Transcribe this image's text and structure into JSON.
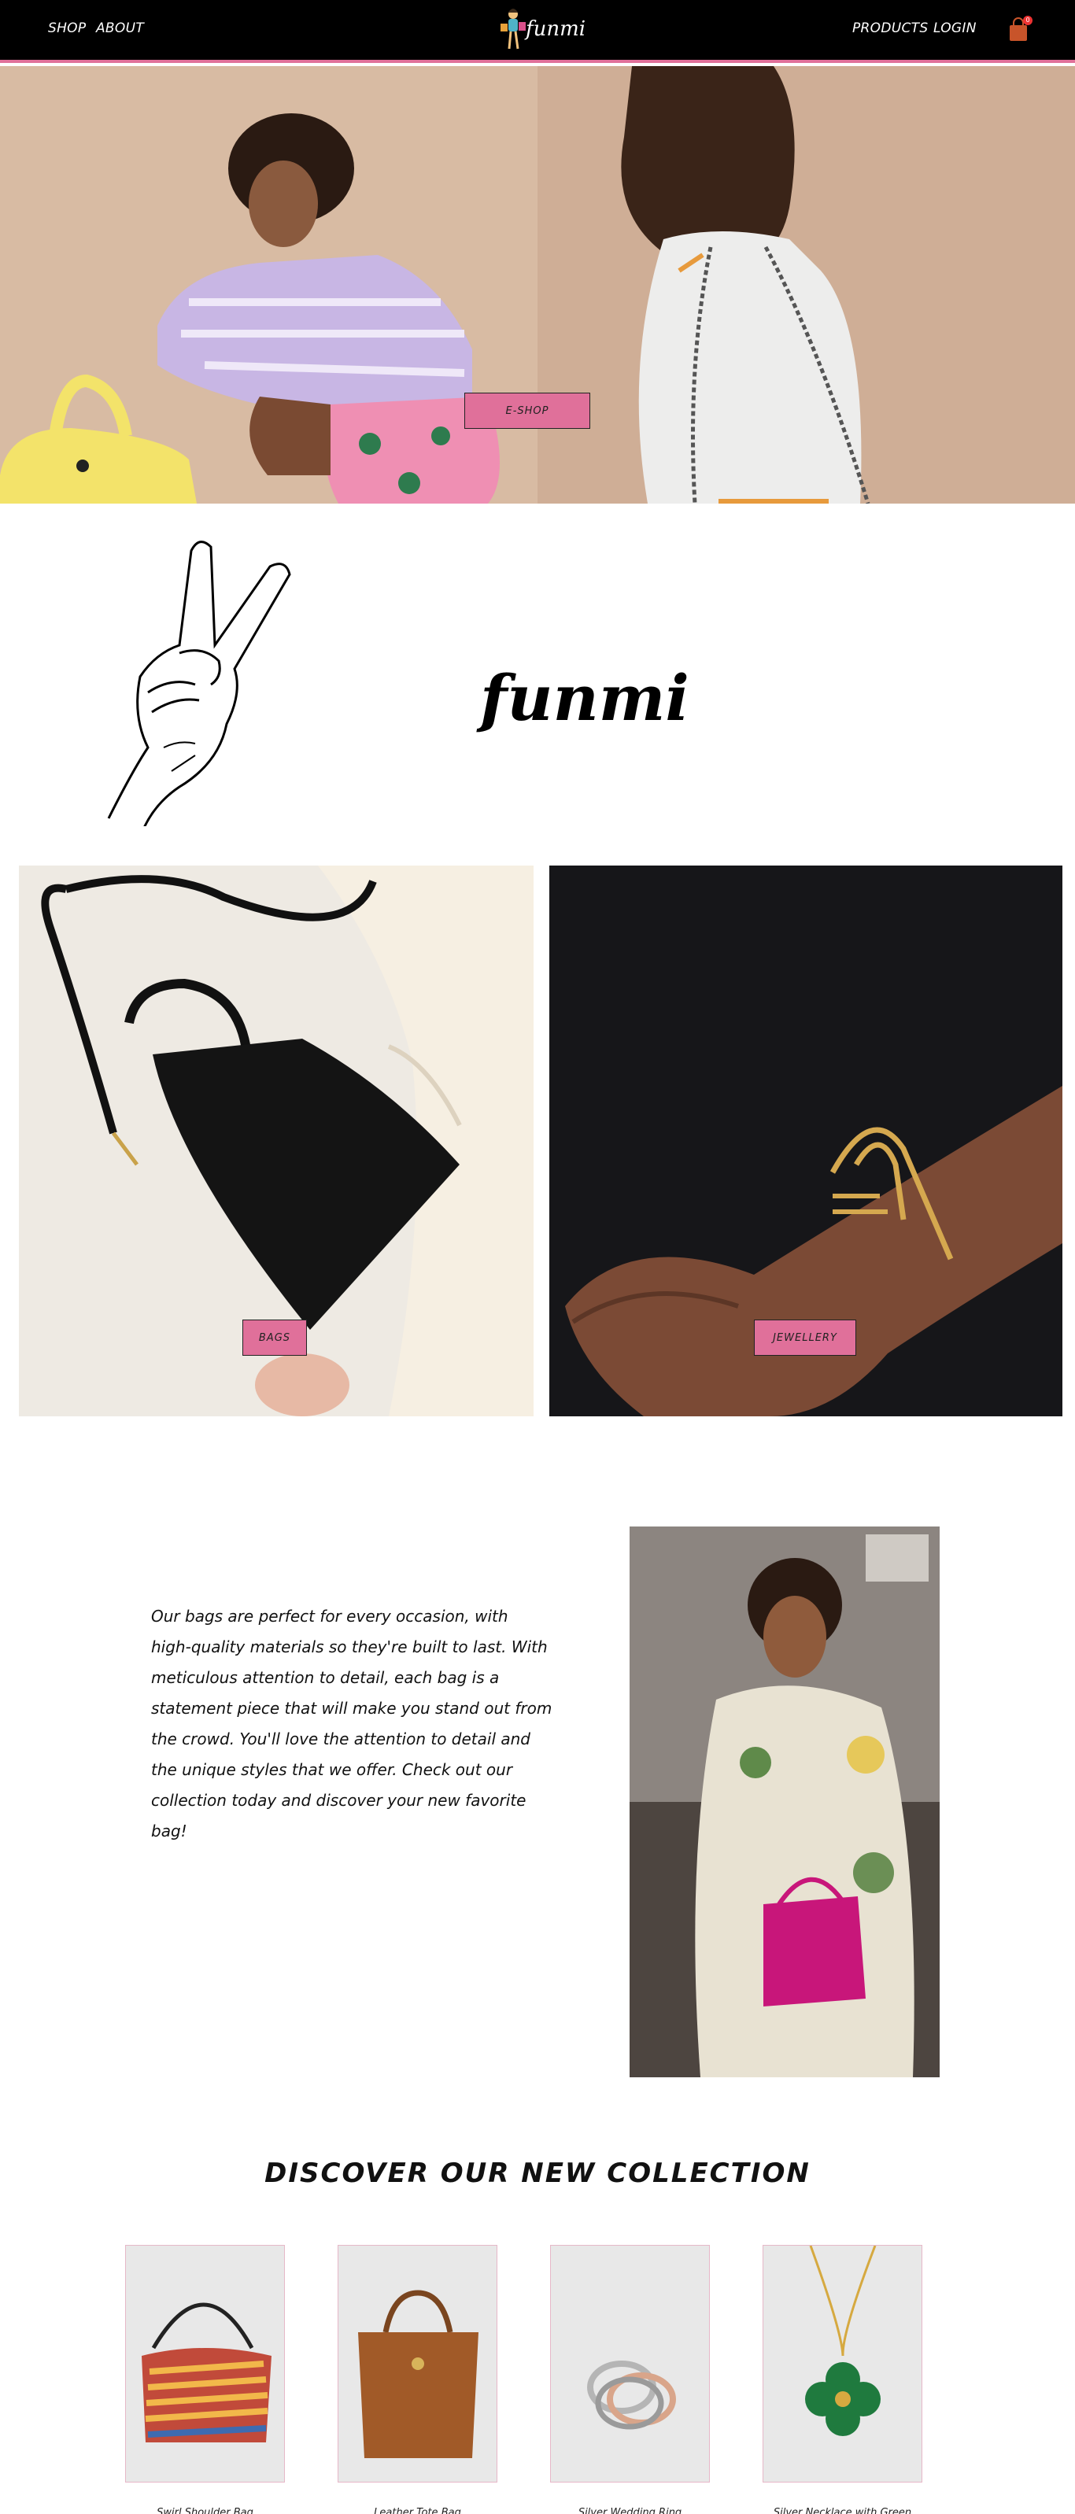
{
  "nav": {
    "shop_label": "SHOP",
    "about_label": "ABOUT",
    "logo_text": "funmi",
    "products_label": "PRODUCTS",
    "login_label": "LOGIN",
    "cart_count": "0",
    "accent": "#e0709a"
  },
  "hero": {
    "eshop_label": "E-SHOP"
  },
  "brand": {
    "name": "funmi"
  },
  "categories": {
    "bags_label": "BAGS",
    "jewellery_label": "JEWELLERY"
  },
  "story": {
    "text": "Our bags are perfect for every occasion, with high-quality materials so they're built to last. With meticulous attention to detail, each bag is a statement piece that will make you stand out from the crowd. You'll love the attention to detail and the unique styles that we offer. Check out our collection today and discover your new favorite bag!"
  },
  "collection": {
    "title": "DISCOVER OUR NEW COLLECTION",
    "products": [
      {
        "name": "Swirl Shoulder Bag"
      },
      {
        "name": "Leather Tote Bag"
      },
      {
        "name": "Silver Wedding Ring"
      },
      {
        "name": "Silver Necklace with Green"
      }
    ]
  }
}
